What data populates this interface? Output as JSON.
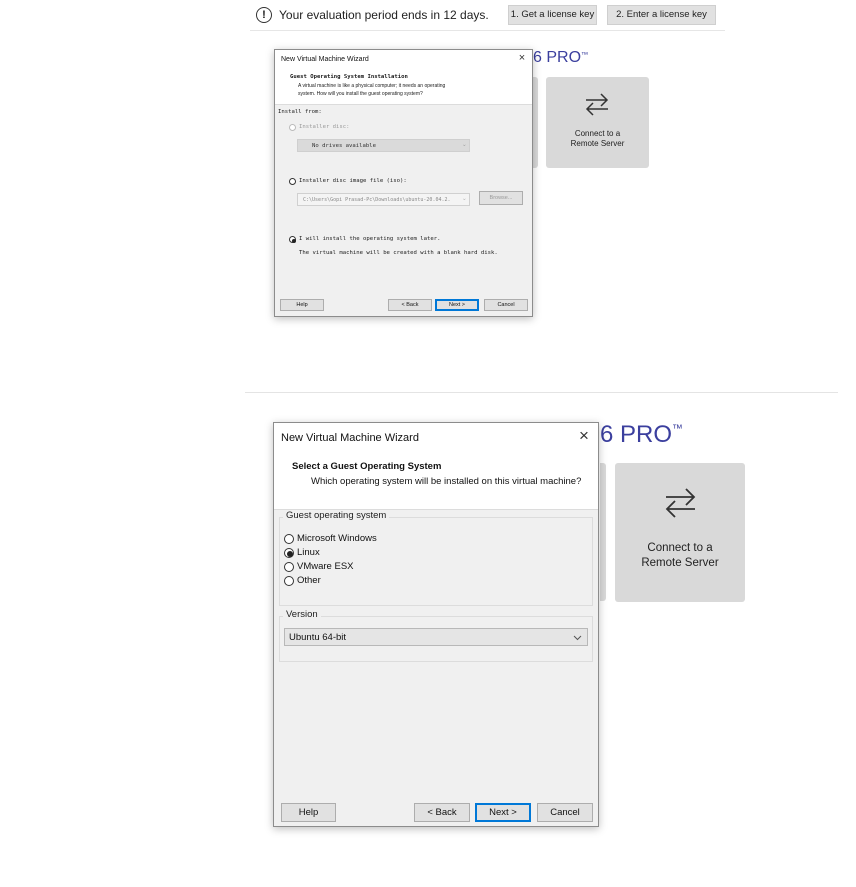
{
  "eval_banner": {
    "message": "Your evaluation period ends in 12 days.",
    "get_license_label": "1. Get a license key",
    "enter_license_label": "2. Enter a license key"
  },
  "brand": {
    "title_visible": "6 PRO",
    "trademark": "™"
  },
  "tile": {
    "line1": "Connect to a",
    "line2": "Remote Server",
    "icon": "swap-arrows-icon"
  },
  "small_wizard": {
    "title": "New Virtual Machine Wizard",
    "close_glyph": "×",
    "heading": "Guest Operating System Installation",
    "subtitle_line1": "A virtual machine is like a physical computer; it needs an operating",
    "subtitle_line2": "system. How will you install the guest operating system?",
    "install_from_label": "Install from:",
    "installer_disc_label": "Installer disc:",
    "installer_disc_value": "No drives available",
    "iso_label": "Installer disc image file (iso):",
    "iso_value": "C:\\Users\\Gopi Prasad-Pc\\Downloads\\ubuntu-20.04.2.",
    "browse_label": "Browse...",
    "later_label": "I will install the operating system later.",
    "later_description": "The virtual machine will be created with a blank hard disk.",
    "selected_option": "later",
    "help_label": "Help",
    "back_label": "< Back",
    "next_label": "Next >",
    "cancel_label": "Cancel"
  },
  "large_wizard": {
    "title": "New Virtual Machine Wizard",
    "close_glyph": "×",
    "heading": "Select a Guest Operating System",
    "subtitle": "Which operating system will be installed on this virtual machine?",
    "guest_os_group_label": "Guest operating system",
    "os_options": [
      {
        "label": "Microsoft Windows",
        "selected": false
      },
      {
        "label": "Linux",
        "selected": true
      },
      {
        "label": "VMware ESX",
        "selected": false
      },
      {
        "label": "Other",
        "selected": false
      }
    ],
    "version_group_label": "Version",
    "version_value": "Ubuntu 64-bit",
    "help_label": "Help",
    "back_label": "< Back",
    "next_label": "Next >",
    "cancel_label": "Cancel"
  },
  "colors": {
    "brand_purple": "#3b3f9e",
    "tile_gray": "#d9d9d9",
    "dialog_body": "#f0f0f0",
    "focus_blue": "#0078d7"
  }
}
